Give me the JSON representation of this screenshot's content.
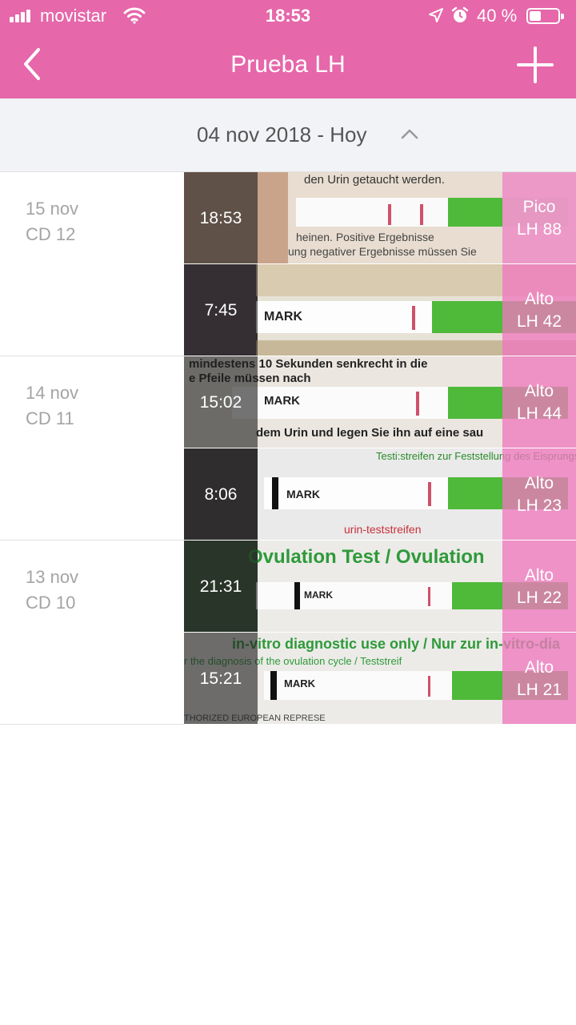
{
  "status_bar": {
    "carrier": "movistar",
    "time": "18:53",
    "battery": "40 %",
    "icons": [
      "signal-icon",
      "wifi-icon",
      "location-icon",
      "alarm-icon",
      "battery-icon"
    ]
  },
  "nav": {
    "title": "Prueba LH",
    "back_icon": "chevron-left-icon",
    "add_icon": "plus-icon"
  },
  "date_header": {
    "label": "04 nov 2018 - Hoy",
    "toggle_icon": "chevron-up-icon"
  },
  "days": [
    {
      "date": "15 nov",
      "cycle_day": "CD 12",
      "entries": [
        {
          "time": "18:53",
          "result": "Pico",
          "value": "LH 88"
        },
        {
          "time": "7:45",
          "result": "Alto",
          "value": "LH 42"
        }
      ]
    },
    {
      "date": "14 nov",
      "cycle_day": "CD 11",
      "entries": [
        {
          "time": "15:02",
          "result": "Alto",
          "value": "LH 44"
        },
        {
          "time": "8:06",
          "result": "Alto",
          "value": "LH 23"
        }
      ]
    },
    {
      "date": "13 nov",
      "cycle_day": "CD 10",
      "entries": [
        {
          "time": "21:31",
          "result": "Alto",
          "value": "LH 22"
        },
        {
          "time": "15:21",
          "result": "Alto",
          "value": "LH 21"
        }
      ]
    }
  ],
  "photo_text": {
    "mark": "MARK",
    "p1_line1": "den Urin getaucht werden.",
    "p1_line2": "heinen. Positive Ergebnisse",
    "p1_line3": "ung negativer Ergebnisse müssen Sie",
    "p3_line1": "mindestens 10 Sekunden senkrecht in die",
    "p3_line2": "e Pfeile müssen nach",
    "p3_line3": "dem Urin und legen Sie ihn auf eine sau",
    "p4_line1": "Testi:streifen zur Feststellung des Eisprungs",
    "p4_line2": "urin-teststreifen",
    "p5_line1": "Ovulation Test / Ovulation",
    "p6_line1": "in-vitro diagnostic use only / Nur zur in-vitro-dia",
    "p6_line2": "r the diagnosis of the ovulation cycle / Teststreif",
    "p6_line3": "THORIZED EUROPEAN REPRESE"
  },
  "colors": {
    "header_pink": "#e667aa",
    "level_pink": "#ee78be",
    "strip_green": "#4fb93a",
    "test_line": "#d0506a"
  }
}
